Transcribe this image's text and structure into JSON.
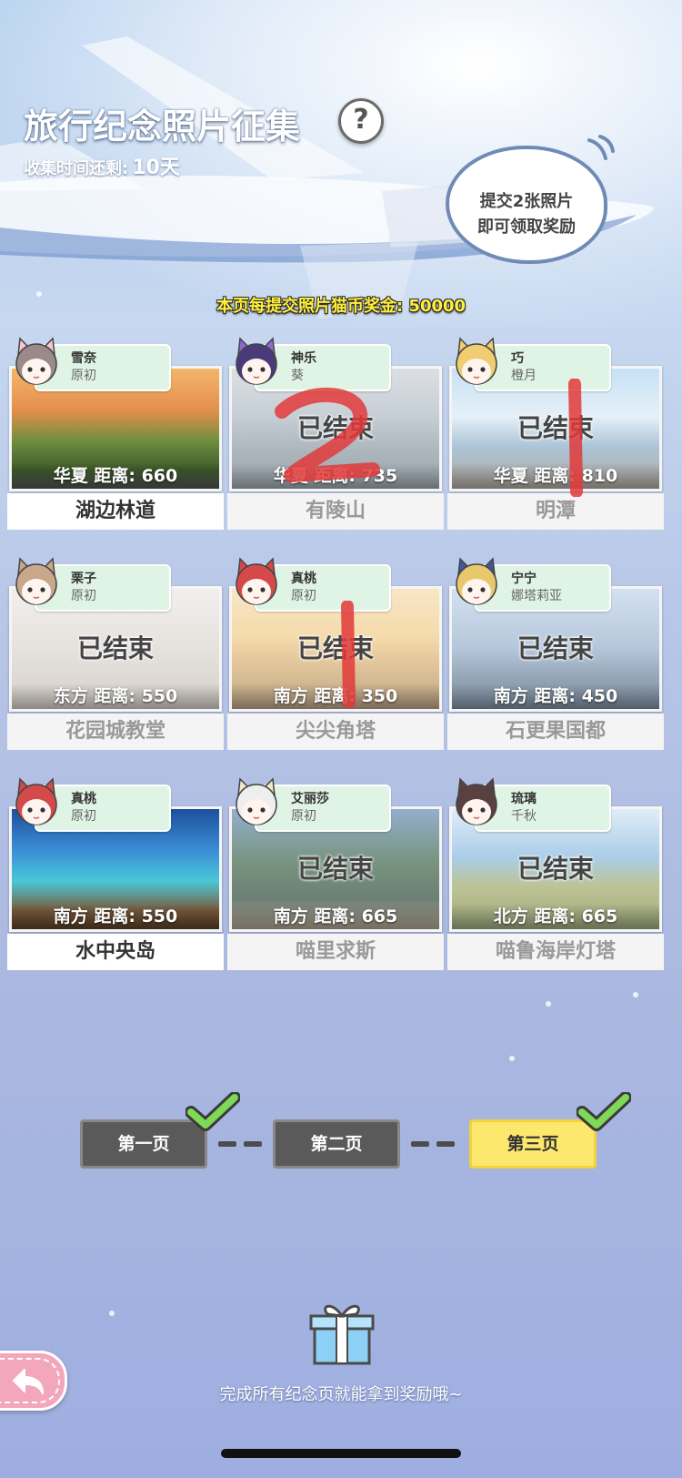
{
  "header": {
    "title": "旅行纪念照片征集",
    "help_label": "?",
    "remaining_label": "收集时间还剩:",
    "remaining_value": "10天",
    "bubble_line1": "提交2张照片",
    "bubble_line2": "即可领取奖励",
    "bonus_text": "本页每提交照片猫币奖金: 50000"
  },
  "cards": [
    {
      "cat": "雪奈",
      "type": "原初",
      "direction_distance": "华夏  距离: 660",
      "name": "湖边林道",
      "ended": false,
      "ended_label": ""
    },
    {
      "cat": "神乐",
      "type": "葵",
      "direction_distance": "华夏  距离: 735",
      "name": "有陵山",
      "ended": true,
      "ended_label": "已结束"
    },
    {
      "cat": "巧",
      "type": "橙月",
      "direction_distance": "华夏  距离: 810",
      "name": "明潭",
      "ended": true,
      "ended_label": "已结束"
    },
    {
      "cat": "栗子",
      "type": "原初",
      "direction_distance": "东方  距离: 550",
      "name": "花园城教堂",
      "ended": true,
      "ended_label": "已结束"
    },
    {
      "cat": "真桃",
      "type": "原初",
      "direction_distance": "南方  距离: 350",
      "name": "尖尖角塔",
      "ended": true,
      "ended_label": "已结束"
    },
    {
      "cat": "宁宁",
      "type": "娜塔莉亚",
      "direction_distance": "南方  距离: 450",
      "name": "石更果国都",
      "ended": true,
      "ended_label": "已结束"
    },
    {
      "cat": "真桃",
      "type": "原初",
      "direction_distance": "南方  距离: 550",
      "name": "水中央岛",
      "ended": false,
      "ended_label": ""
    },
    {
      "cat": "艾丽莎",
      "type": "原初",
      "direction_distance": "南方  距离: 665",
      "name": "喵里求斯",
      "ended": true,
      "ended_label": "已结束"
    },
    {
      "cat": "琉璃",
      "type": "千秋",
      "direction_distance": "北方  距离: 665",
      "name": "喵鲁海岸灯塔",
      "ended": true,
      "ended_label": "已结束"
    }
  ],
  "pagination": {
    "page1": "第一页",
    "page2": "第二页",
    "page3": "第三页",
    "active": 3
  },
  "footer": {
    "text": "完成所有纪念页就能拿到奖励哦~"
  },
  "colors": {
    "tag_bg": "#dff4e4",
    "page_active": "#fde86e",
    "page_inactive": "#5a5a5a",
    "check_green": "#7ed957",
    "bonus_yellow": "#ffef3a",
    "back_pink": "#f3a7bd"
  },
  "icons": {
    "help": "question-icon",
    "back": "back-arrow-icon",
    "gift": "gift-icon",
    "check": "checkmark-icon"
  }
}
